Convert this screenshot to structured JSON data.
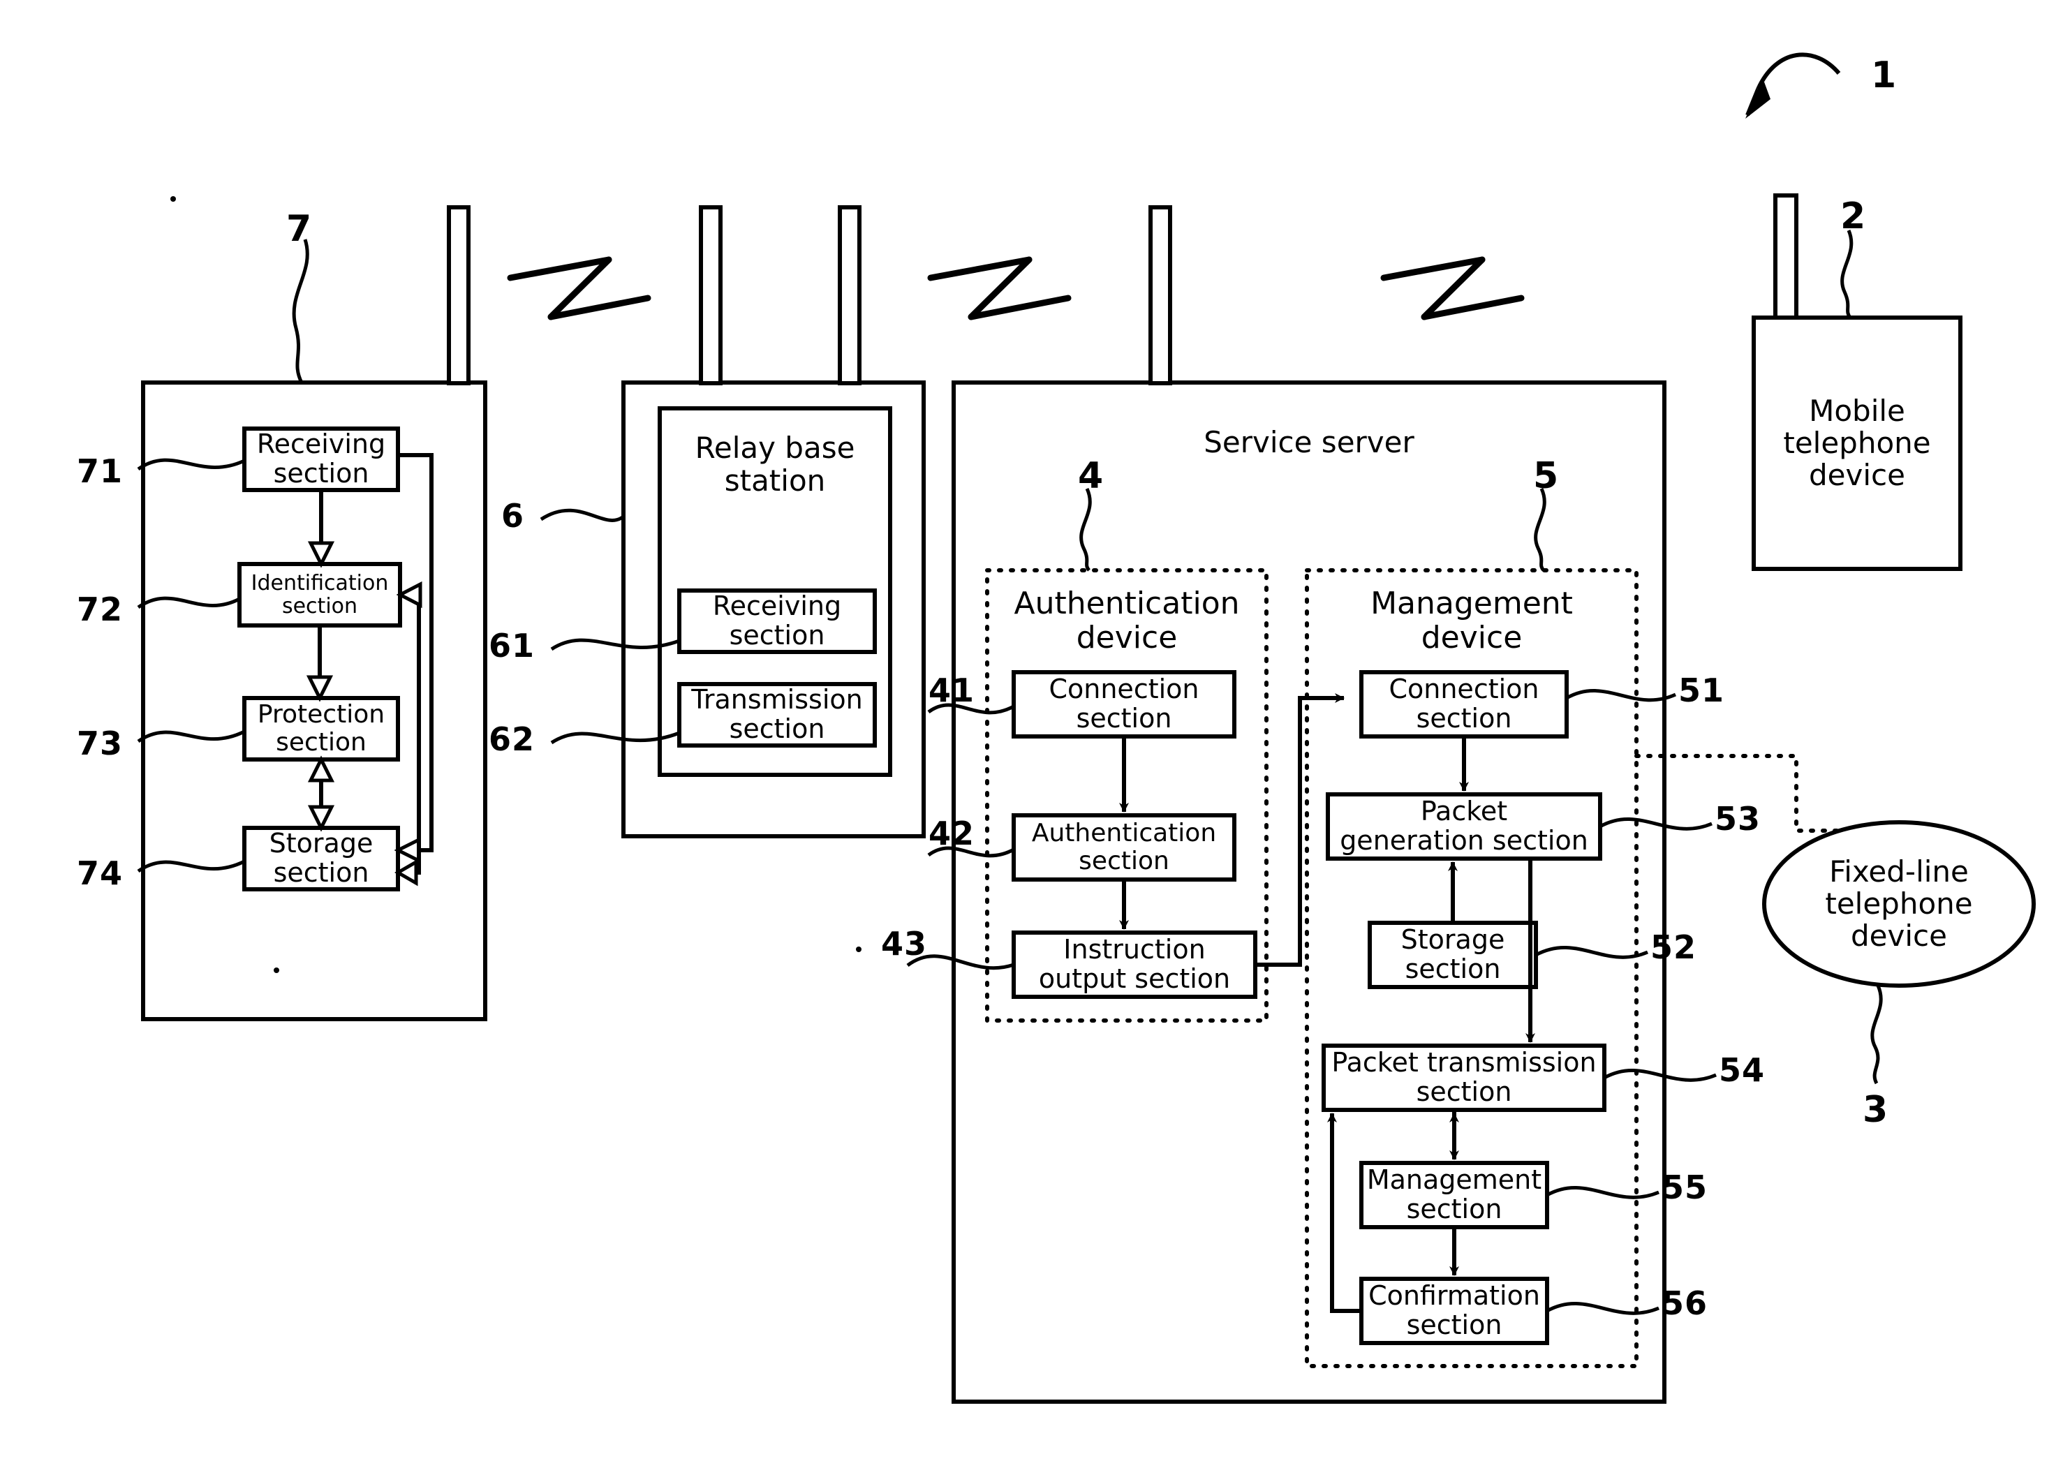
{
  "figure": {
    "type": "patent-block-diagram",
    "system_ref": "1"
  },
  "devices": {
    "mobile_telephone": {
      "label": "Mobile\ntelephone\ndevice",
      "ref": "2"
    },
    "fixed_line_telephone": {
      "label": "Fixed-line\ntelephone\ndevice",
      "ref": "3"
    },
    "terminal": {
      "ref": "7",
      "sections": [
        {
          "label": "Receiving\nsection",
          "ref": "71"
        },
        {
          "label": "Identification\nsection",
          "ref": "72"
        },
        {
          "label": "Protection\nsection",
          "ref": "73"
        },
        {
          "label": "Storage\nsection",
          "ref": "74"
        }
      ]
    },
    "relay_base_station": {
      "title": "Relay base\nstation",
      "ref": "6",
      "sections": [
        {
          "label": "Receiving\nsection",
          "ref": "61"
        },
        {
          "label": "Transmission\nsection",
          "ref": "62"
        }
      ]
    },
    "service_server": {
      "title": "Service server",
      "authentication_device": {
        "title": "Authentication\ndevice",
        "ref": "4",
        "sections": [
          {
            "label": "Connection\nsection",
            "ref": "41"
          },
          {
            "label": "Authentication\nsection",
            "ref": "42"
          },
          {
            "label": "Instruction\noutput section",
            "ref": "43"
          }
        ]
      },
      "management_device": {
        "title": "Management\ndevice",
        "ref": "5",
        "sections": [
          {
            "label": "Connection\nsection",
            "ref": "51"
          },
          {
            "label": "Storage\nsection",
            "ref": "52"
          },
          {
            "label": "Packet\ngeneration section",
            "ref": "53"
          },
          {
            "label": "Packet transmission\nsection",
            "ref": "54"
          },
          {
            "label": "Management\nsection",
            "ref": "55"
          },
          {
            "label": "Confirmation\nsection",
            "ref": "56"
          }
        ]
      }
    }
  },
  "icons": {
    "antenna": "antenna-icon",
    "wireless_link": "wireless-link-icon"
  },
  "colors": {
    "stroke": "#000000",
    "background": "#ffffff"
  }
}
